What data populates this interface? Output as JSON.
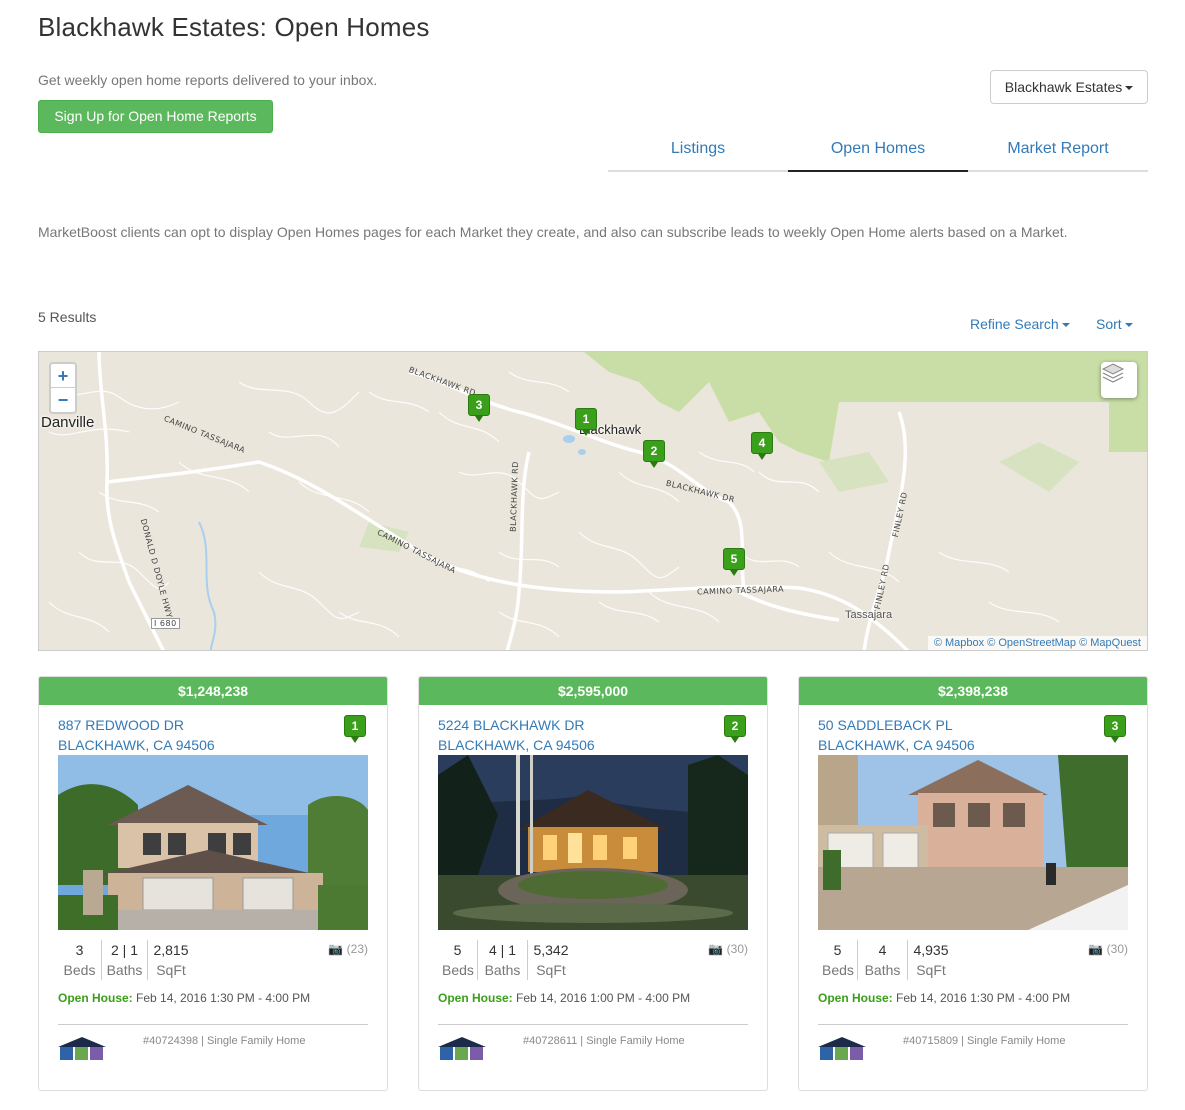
{
  "header": {
    "title": "Blackhawk Estates: Open Homes",
    "subtext": "Get weekly open home reports delivered to your inbox.",
    "signup_label": "Sign Up for Open Home Reports",
    "market_select": "Blackhawk Estates"
  },
  "tabs": [
    {
      "label": "Listings",
      "active": false
    },
    {
      "label": "Open Homes",
      "active": true
    },
    {
      "label": "Market Report",
      "active": false
    }
  ],
  "description": "MarketBoost clients can opt to display Open Homes pages for each Market they create, and also can subscribe leads to weekly Open Home alerts based on a Market.",
  "results": {
    "count_label": "5 Results",
    "refine_label": "Refine Search",
    "sort_label": "Sort"
  },
  "map": {
    "zoom_in": "+",
    "zoom_out": "−",
    "city_danville": "Danville",
    "city_blackhawk": "Blackhawk",
    "town_tassajara": "Tassajara",
    "roads": {
      "blackhawk_rd": "BLACKHAWK RD",
      "camino_tassajara": "CAMINO TASSAJARA",
      "camino_tassajara_2": "CAMINO TASSAJARA",
      "camino_tassajara_3": "CAMINO TASSAJARA",
      "blackhawk_rd_2": "BLACKHAWK RD",
      "blackhawk_dr": "BLACKHAWK DR",
      "finley_rd": "FINLEY RD",
      "finley_rd_2": "FINLEY RD",
      "donald_doyle": "DONALD D DOYLE HWY",
      "i680": "I 680"
    },
    "pins": [
      "1",
      "2",
      "3",
      "4",
      "5"
    ],
    "attribution": "© Mapbox © OpenStreetMap © MapQuest"
  },
  "listings": [
    {
      "price": "$1,248,238",
      "address_line1": "887 REDWOOD DR",
      "address_line2": "BLACKHAWK, CA 94506",
      "badge": "1",
      "beds": "3",
      "beds_label": "Beds",
      "baths": "2 | 1",
      "baths_label": "Baths",
      "sqft": "2,815",
      "sqft_label": "SqFt",
      "photo_count": "(23)",
      "open_house_label": "Open House:",
      "open_house_time": "Feb 14, 2016 1:30 PM - 4:00 PM",
      "meta": "#40724398 | Single Family Home"
    },
    {
      "price": "$2,595,000",
      "address_line1": "5224 BLACKHAWK DR",
      "address_line2": "BLACKHAWK, CA 94506",
      "badge": "2",
      "beds": "5",
      "beds_label": "Beds",
      "baths": "4 | 1",
      "baths_label": "Baths",
      "sqft": "5,342",
      "sqft_label": "SqFt",
      "photo_count": "(30)",
      "open_house_label": "Open House:",
      "open_house_time": "Feb 14, 2016 1:00 PM - 4:00 PM",
      "meta": "#40728611 | Single Family Home"
    },
    {
      "price": "$2,398,238",
      "address_line1": "50 SADDLEBACK PL",
      "address_line2": "BLACKHAWK, CA 94506",
      "badge": "3",
      "beds": "5",
      "beds_label": "Beds",
      "baths": "4",
      "baths_label": "Baths",
      "sqft": "4,935",
      "sqft_label": "SqFt",
      "photo_count": "(30)",
      "open_house_label": "Open House:",
      "open_house_time": "Feb 14, 2016 1:30 PM - 4:00 PM",
      "meta": "#40715809 | Single Family Home"
    }
  ],
  "colors": {
    "accent": "#5cb85c",
    "link": "#337ab7",
    "pin": "#3a9f1a"
  }
}
